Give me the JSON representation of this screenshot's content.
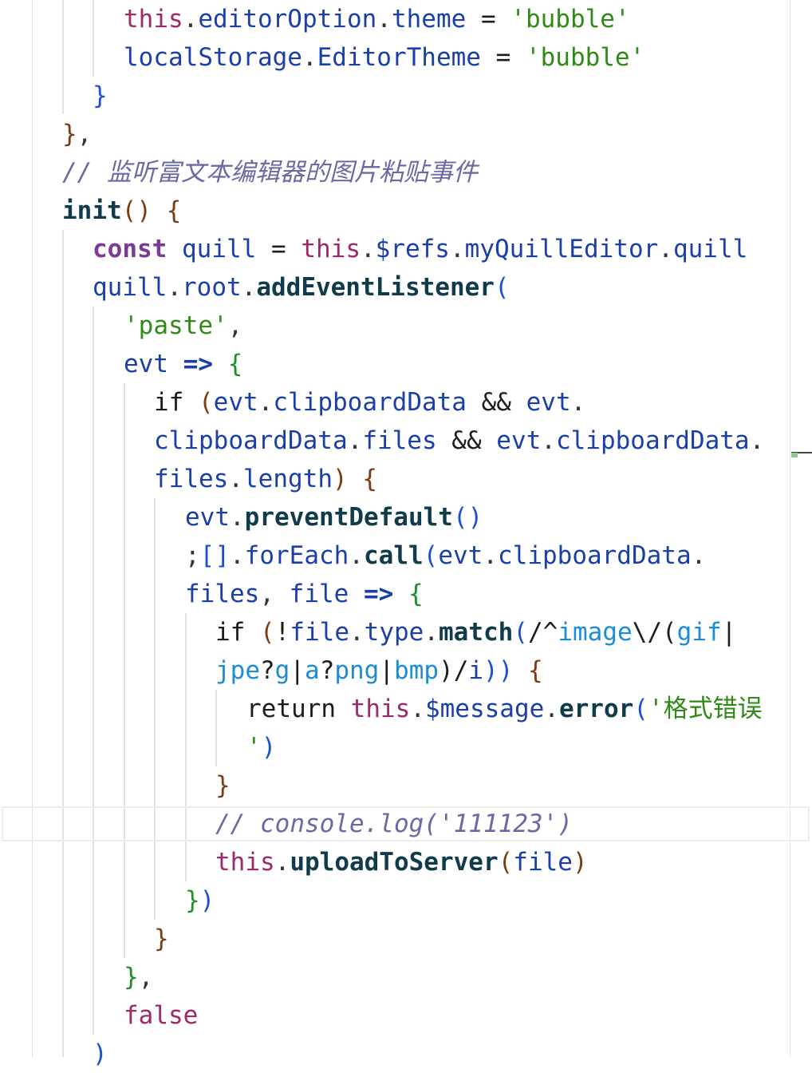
{
  "editor": {
    "lines": [
      {
        "tokens": [
          [
            "kw",
            "this"
          ],
          [
            "punc",
            "."
          ],
          [
            "prop",
            "editorOption"
          ],
          [
            "punc",
            "."
          ],
          [
            "prop",
            "theme"
          ],
          [
            "op",
            " = "
          ],
          [
            "str",
            "'bubble'"
          ]
        ]
      },
      {
        "tokens": [
          [
            "var",
            "localStorage"
          ],
          [
            "punc",
            "."
          ],
          [
            "prop",
            "EditorTheme"
          ],
          [
            "op",
            " = "
          ],
          [
            "str",
            "'bubble'"
          ]
        ]
      },
      {
        "tokens": [
          [
            "brc",
            "}"
          ]
        ]
      },
      {
        "tokens": [
          [
            "brc2",
            "}"
          ],
          [
            "punc",
            ","
          ]
        ]
      },
      {
        "tokens": [
          [
            "com",
            "// 监听富文本编辑器的图片粘贴事件"
          ]
        ]
      },
      {
        "tokens": [
          [
            "fn",
            "init"
          ],
          [
            "brc2",
            "()"
          ],
          [
            "plain",
            " "
          ],
          [
            "brc2",
            "{"
          ]
        ]
      },
      {
        "tokens": [
          [
            "kwb",
            "const"
          ],
          [
            "plain",
            " "
          ],
          [
            "var",
            "quill"
          ],
          [
            "op",
            " = "
          ],
          [
            "kw",
            "this"
          ],
          [
            "punc",
            "."
          ],
          [
            "prop",
            "$refs"
          ],
          [
            "punc",
            "."
          ],
          [
            "prop",
            "myQuillEditor"
          ],
          [
            "punc",
            "."
          ],
          [
            "prop",
            "quill"
          ]
        ]
      },
      {
        "tokens": [
          [
            "var",
            "quill"
          ],
          [
            "punc",
            "."
          ],
          [
            "prop",
            "root"
          ],
          [
            "punc",
            "."
          ],
          [
            "fn",
            "addEventListener"
          ],
          [
            "brc",
            "("
          ]
        ]
      },
      {
        "tokens": [
          [
            "str",
            "'paste'"
          ],
          [
            "punc",
            ","
          ]
        ]
      },
      {
        "tokens": [
          [
            "var",
            "evt"
          ],
          [
            "plain",
            " "
          ],
          [
            "arrow",
            "=>"
          ],
          [
            "plain",
            " "
          ],
          [
            "brc3",
            "{"
          ]
        ]
      },
      {
        "tokens": [
          [
            "plain",
            "if "
          ],
          [
            "brc2",
            "("
          ],
          [
            "var",
            "evt"
          ],
          [
            "punc",
            "."
          ],
          [
            "prop",
            "clipboardData"
          ],
          [
            "op",
            " && "
          ],
          [
            "var",
            "evt"
          ],
          [
            "punc",
            "."
          ]
        ]
      },
      {
        "tokens": [
          [
            "prop",
            "clipboardData"
          ],
          [
            "punc",
            "."
          ],
          [
            "prop",
            "files"
          ],
          [
            "op",
            " && "
          ],
          [
            "var",
            "evt"
          ],
          [
            "punc",
            "."
          ],
          [
            "prop",
            "clipboardData"
          ],
          [
            "punc",
            "."
          ]
        ]
      },
      {
        "tokens": [
          [
            "prop",
            "files"
          ],
          [
            "punc",
            "."
          ],
          [
            "prop",
            "length"
          ],
          [
            "brc2",
            ")"
          ],
          [
            "plain",
            " "
          ],
          [
            "brc2",
            "{"
          ]
        ]
      },
      {
        "tokens": [
          [
            "var",
            "evt"
          ],
          [
            "punc",
            "."
          ],
          [
            "fn",
            "preventDefault"
          ],
          [
            "brc",
            "()"
          ]
        ]
      },
      {
        "tokens": [
          [
            "punc",
            ";"
          ],
          [
            "brc",
            "[]"
          ],
          [
            "punc",
            "."
          ],
          [
            "prop",
            "forEach"
          ],
          [
            "punc",
            "."
          ],
          [
            "fn",
            "call"
          ],
          [
            "brc",
            "("
          ],
          [
            "var",
            "evt"
          ],
          [
            "punc",
            "."
          ],
          [
            "prop",
            "clipboardData"
          ],
          [
            "punc",
            "."
          ]
        ]
      },
      {
        "tokens": [
          [
            "prop",
            "files"
          ],
          [
            "punc",
            ","
          ],
          [
            "plain",
            " "
          ],
          [
            "var",
            "file"
          ],
          [
            "plain",
            " "
          ],
          [
            "arrow",
            "=>"
          ],
          [
            "plain",
            " "
          ],
          [
            "brc3",
            "{"
          ]
        ]
      },
      {
        "tokens": [
          [
            "plain",
            "if "
          ],
          [
            "brc2",
            "("
          ],
          [
            "plain",
            "!"
          ],
          [
            "var",
            "file"
          ],
          [
            "punc",
            "."
          ],
          [
            "prop",
            "type"
          ],
          [
            "punc",
            "."
          ],
          [
            "fn",
            "match"
          ],
          [
            "brc",
            "("
          ],
          [
            "plain",
            "/^"
          ],
          [
            "rx",
            "image"
          ],
          [
            "plain",
            "\\/("
          ],
          [
            "rx",
            "gif"
          ],
          [
            "plain",
            "|"
          ]
        ]
      },
      {
        "tokens": [
          [
            "rx",
            "jpe"
          ],
          [
            "plain",
            "?"
          ],
          [
            "rx",
            "g"
          ],
          [
            "plain",
            "|"
          ],
          [
            "rx",
            "a"
          ],
          [
            "plain",
            "?"
          ],
          [
            "rx",
            "png"
          ],
          [
            "plain",
            "|"
          ],
          [
            "rx",
            "bmp"
          ],
          [
            "plain",
            ")/"
          ],
          [
            "var",
            "i"
          ],
          [
            "brc",
            "))"
          ],
          [
            "plain",
            " "
          ],
          [
            "brc2",
            "{"
          ]
        ]
      },
      {
        "tokens": [
          [
            "plain",
            "return "
          ],
          [
            "kw",
            "this"
          ],
          [
            "punc",
            "."
          ],
          [
            "prop",
            "$message"
          ],
          [
            "punc",
            "."
          ],
          [
            "fn",
            "error"
          ],
          [
            "brc",
            "("
          ],
          [
            "str",
            "'格式错误"
          ]
        ]
      },
      {
        "tokens": [
          [
            "str",
            "'"
          ],
          [
            "brc",
            ")"
          ]
        ]
      },
      {
        "tokens": [
          [
            "brc2",
            "}"
          ]
        ]
      },
      {
        "tokens": [
          [
            "com",
            "// console.log('111123')"
          ]
        ]
      },
      {
        "tokens": [
          [
            "kw",
            "this"
          ],
          [
            "punc",
            "."
          ],
          [
            "fn",
            "uploadToServer"
          ],
          [
            "brc2",
            "("
          ],
          [
            "var",
            "file"
          ],
          [
            "brc2",
            ")"
          ]
        ]
      },
      {
        "tokens": [
          [
            "brc3",
            "}"
          ],
          [
            "brc",
            ")"
          ]
        ]
      },
      {
        "tokens": [
          [
            "brc2",
            "}"
          ]
        ]
      },
      {
        "tokens": [
          [
            "brc3",
            "}"
          ],
          [
            "punc",
            ","
          ]
        ]
      },
      {
        "tokens": [
          [
            "kw",
            "false"
          ]
        ]
      },
      {
        "tokens": [
          [
            "brc",
            ")"
          ]
        ]
      }
    ]
  }
}
